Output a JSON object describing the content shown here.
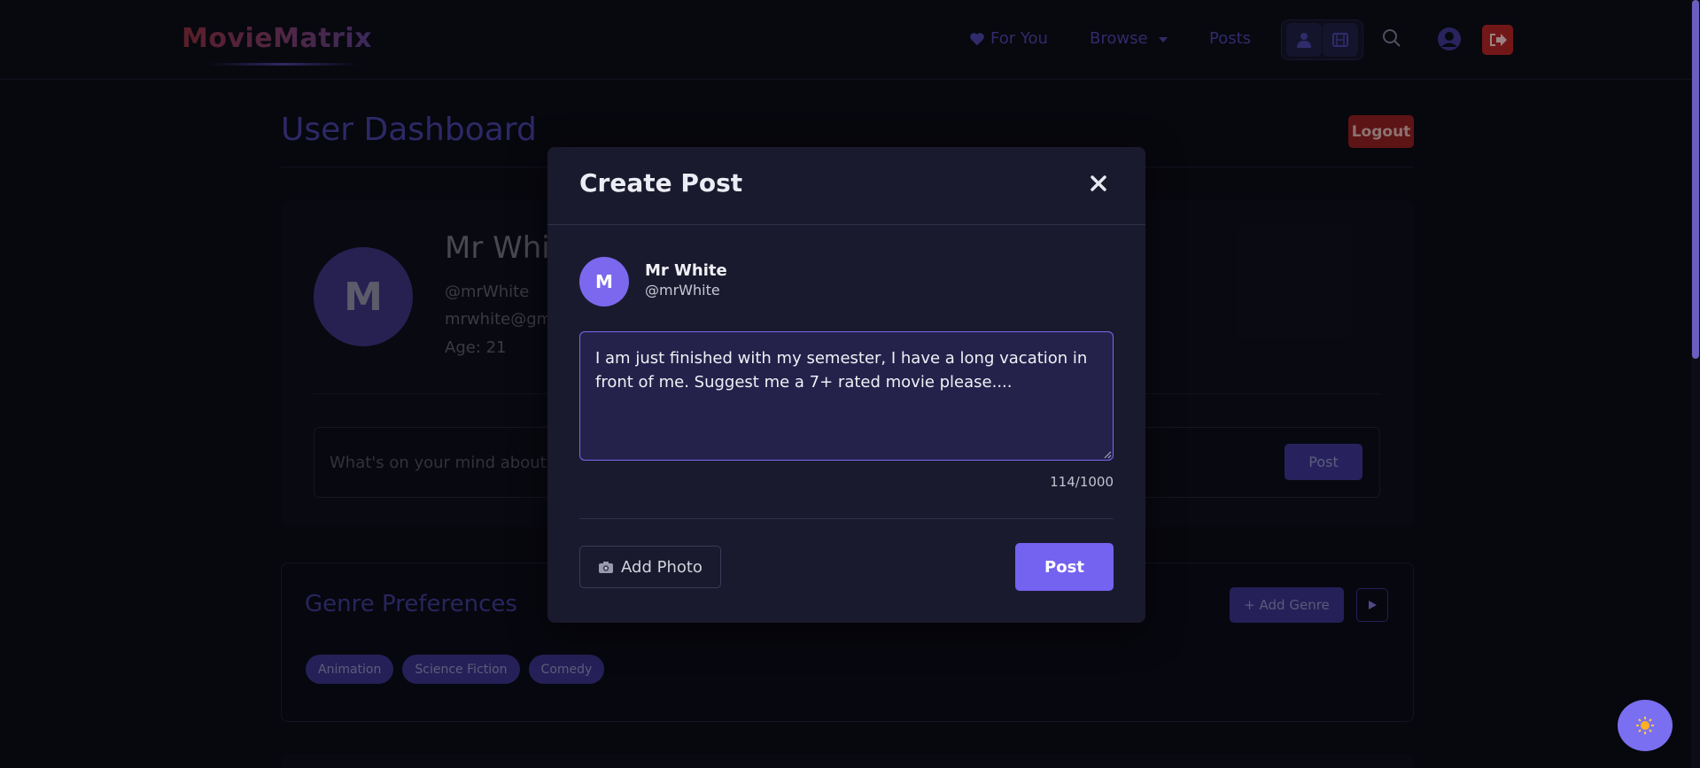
{
  "navbar": {
    "brand": "MovieMatrix",
    "links": [
      {
        "label": "For You",
        "icon": "heart-icon"
      },
      {
        "label": "Browse",
        "icon": "chevron-down-icon"
      },
      {
        "label": "Posts"
      }
    ],
    "icons": [
      "user-icon",
      "film-icon",
      "search-icon",
      "user-circle-icon",
      "logout-icon"
    ]
  },
  "page": {
    "title": "User Dashboard",
    "logout_label": "Logout",
    "profile": {
      "initial": "M",
      "name": "Mr Whit",
      "username": "@mrWhite",
      "email": "mrwhite@gm",
      "age": "Age: 21"
    },
    "composer": {
      "placeholder": "What's on your mind about",
      "post_label": "Post"
    },
    "genres": {
      "title": "Genre Preferences",
      "add_label": "+ Add Genre",
      "tags": [
        "Animation",
        "Science Fiction",
        "Comedy"
      ]
    }
  },
  "modal": {
    "title": "Create Post",
    "user": {
      "initial": "M",
      "name": "Mr White",
      "username": "@mrWhite"
    },
    "text": "I am just finished with my semester, I have a long vacation in front of me. Suggest me a 7+ rated movie please....",
    "char_count": "114/1000",
    "add_photo_label": "Add Photo",
    "post_label": "Post"
  },
  "colors": {
    "accent": "#7462f0",
    "background": "#0b0b16",
    "modal_bg": "#1a1a2e",
    "danger": "#b02424"
  }
}
